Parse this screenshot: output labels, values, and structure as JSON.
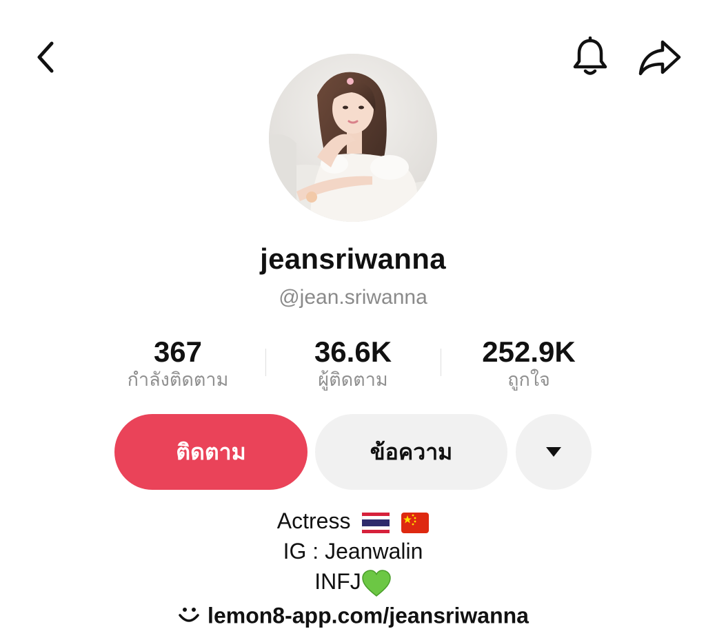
{
  "header": {
    "back_icon": "chevron-left-icon",
    "bell_icon": "bell-icon",
    "share_icon": "share-arrow-icon"
  },
  "profile": {
    "display_name": "jeansriwanna",
    "handle": "@jean.sriwanna"
  },
  "stats": [
    {
      "value": "367",
      "label": "กำลังติดตาม"
    },
    {
      "value": "36.6K",
      "label": "ผู้ติดตาม"
    },
    {
      "value": "252.9K",
      "label": "ถูกใจ"
    }
  ],
  "actions": {
    "follow_label": "ติดตาม",
    "message_label": "ข้อความ",
    "more_icon": "caret-down-icon"
  },
  "bio": {
    "line1": "Actress",
    "line1_flags": [
      "thailand-flag-icon",
      "china-flag-icon"
    ],
    "line2": "IG : Jeanwalin",
    "line3": "INFJ",
    "line3_emoji": "green-heart-icon",
    "link": "lemon8-app.com/jeansriwanna",
    "link_icon": "smile-icon"
  },
  "colors": {
    "follow_button": "#ea4359",
    "secondary_button": "#f1f1f1",
    "muted_text": "#8a8a8a"
  }
}
